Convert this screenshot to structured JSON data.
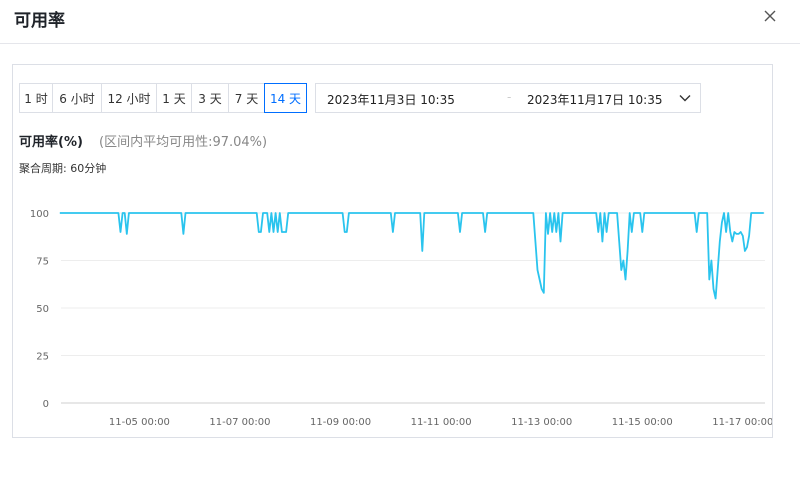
{
  "dialog": {
    "title": "可用率"
  },
  "toolbar": {
    "ranges": [
      "1 时",
      "6 小时",
      "12 小时",
      "1 天",
      "3 天",
      "7 天",
      "14 天"
    ],
    "active_range": "14 天",
    "date_start": "2023年11月3日 10:35",
    "date_separator": "-",
    "date_end": "2023年11月17日 10:35"
  },
  "metric": {
    "title": "可用率(%)",
    "average_text": "(区间内平均可用性:97.04%)",
    "aggregation": "聚合周期: 60分钟"
  },
  "chart_data": {
    "type": "line",
    "title": "可用率(%)",
    "subtitle": "(区间内平均可用性:97.04%)",
    "xlabel": "",
    "ylabel": "",
    "x_range": [
      "2023-11-03 10:35",
      "2023-11-17 10:35"
    ],
    "ylim": [
      0,
      100
    ],
    "y_ticks": [
      0,
      25,
      50,
      75,
      100
    ],
    "x_ticks": [
      "11-05 00:00",
      "11-07 00:00",
      "11-09 00:00",
      "11-11 00:00",
      "11-13 00:00",
      "11-15 00:00",
      "11-17 00:00"
    ],
    "grid": "horizontal",
    "line_color": "#2ac4ee",
    "series": [
      {
        "x": [
          "11-03 10:00",
          "11-04 14:00",
          "11-04 15:00",
          "11-04 16:00",
          "11-04 17:00",
          "11-04 18:00",
          "11-04 19:00",
          "11-05 20:00",
          "11-05 21:00",
          "11-05 22:00",
          "11-07 08:00",
          "11-07 09:00",
          "11-07 10:00",
          "11-07 11:00",
          "11-07 13:00",
          "11-07 14:00",
          "11-07 15:00",
          "11-07 16:00",
          "11-07 17:00",
          "11-07 18:00",
          "11-07 19:00",
          "11-07 20:00",
          "11-07 21:00",
          "11-07 22:00",
          "11-07 23:00",
          "11-08 00:00",
          "11-08 01:00",
          "11-09 01:00",
          "11-09 02:00",
          "11-09 03:00",
          "11-09 04:00",
          "11-10 00:00",
          "11-10 01:00",
          "11-10 02:00",
          "11-10 14:00",
          "11-10 15:00",
          "11-10 16:00",
          "11-10 17:00",
          "11-11 08:00",
          "11-11 09:00",
          "11-11 10:00",
          "11-11 20:00",
          "11-11 21:00",
          "11-11 22:00",
          "11-12 20:00",
          "11-12 21:00",
          "11-12 22:00",
          "11-12 23:00",
          "11-13 00:00",
          "11-13 01:00",
          "11-13 02:00",
          "11-13 03:00",
          "11-13 04:00",
          "11-13 05:00",
          "11-13 06:00",
          "11-13 07:00",
          "11-13 08:00",
          "11-13 09:00",
          "11-13 10:00",
          "11-13 11:00",
          "11-13 12:00",
          "11-13 13:00",
          "11-13 14:00",
          "11-13 15:00",
          "11-13 16:00",
          "11-14 02:00",
          "11-14 03:00",
          "11-14 04:00",
          "11-14 05:00",
          "11-14 06:00",
          "11-14 07:00",
          "11-14 08:00",
          "11-14 12:00",
          "11-14 13:00",
          "11-14 14:00",
          "11-14 15:00",
          "11-14 16:00",
          "11-14 17:00",
          "11-14 18:00",
          "11-14 19:00",
          "11-14 20:00",
          "11-14 21:00",
          "11-14 22:00",
          "11-14 23:00",
          "11-15 00:00",
          "11-15 01:00",
          "11-15 02:00",
          "11-15 03:00",
          "11-15 04:00",
          "11-15 05:00",
          "11-16 01:00",
          "11-16 02:00",
          "11-16 03:00",
          "11-16 07:00",
          "11-16 08:00",
          "11-16 09:00",
          "11-16 10:00",
          "11-16 11:00",
          "11-16 12:00",
          "11-16 13:00",
          "11-16 14:00",
          "11-16 15:00",
          "11-16 16:00",
          "11-16 17:00",
          "11-16 18:00",
          "11-16 19:00",
          "11-16 20:00",
          "11-16 21:00",
          "11-16 22:00",
          "11-16 23:00",
          "11-17 00:00",
          "11-17 01:00",
          "11-17 02:00",
          "11-17 03:00",
          "11-17 04:00",
          "11-17 05:00",
          "11-17 10:00"
        ],
        "values": [
          100,
          100,
          90,
          100,
          100,
          89,
          100,
          100,
          89,
          100,
          100,
          90,
          90,
          100,
          100,
          90,
          100,
          90,
          100,
          90,
          100,
          90,
          90,
          90,
          100,
          100,
          100,
          100,
          90,
          90,
          100,
          100,
          90,
          100,
          100,
          80,
          100,
          100,
          100,
          90,
          100,
          100,
          90,
          100,
          100,
          85,
          70,
          65,
          60,
          58,
          100,
          89,
          100,
          90,
          100,
          90,
          100,
          85,
          100,
          100,
          100,
          100,
          100,
          100,
          100,
          100,
          90,
          100,
          85,
          100,
          90,
          100,
          100,
          85,
          70,
          75,
          65,
          80,
          100,
          90,
          100,
          100,
          100,
          100,
          90,
          100,
          100,
          100,
          100,
          100,
          100,
          90,
          100,
          100,
          65,
          75,
          60,
          55,
          70,
          85,
          95,
          100,
          90,
          100,
          90,
          85,
          90,
          89,
          89,
          90,
          88,
          80,
          82,
          88,
          100,
          100,
          100
        ]
      }
    ]
  }
}
